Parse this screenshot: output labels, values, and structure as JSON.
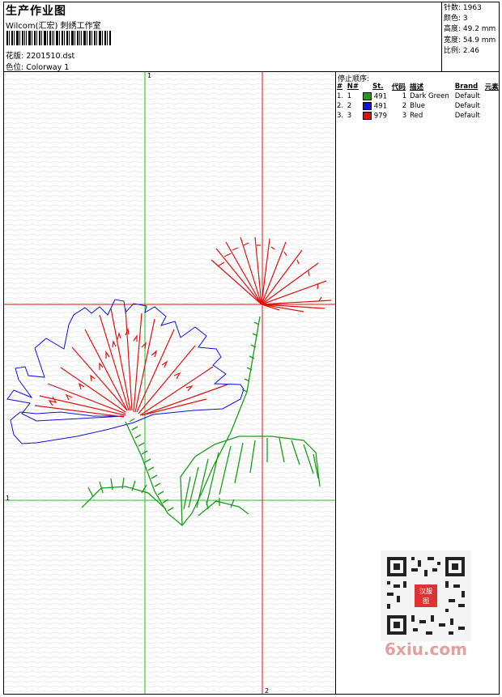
{
  "header": {
    "title": "生产作业图",
    "subtitle": "Wilcom(汇宏) 刺绣工作室",
    "design_label": "花版: 2201510.dst",
    "colorway_label": "色位: Colorway 1"
  },
  "stats": {
    "stitches": "针数: 1963",
    "colors": "颜色: 3",
    "height": "高度: 49.2 mm",
    "width": "宽度: 54.9 mm",
    "scale": "比例: 2.46"
  },
  "sequence": {
    "title": "停止顺序:",
    "headers": [
      "#",
      "N#",
      "St.",
      "代码",
      "描述",
      "Brand",
      "元素"
    ],
    "rows": [
      {
        "idx": "1.",
        "n": "1",
        "color": "#1a9c1a",
        "st": "491",
        "code": "1",
        "desc": "Dark Green",
        "brand": "Default"
      },
      {
        "idx": "2.",
        "n": "2",
        "color": "#1010e0",
        "st": "491",
        "code": "2",
        "desc": "Blue",
        "brand": "Default"
      },
      {
        "idx": "3.",
        "n": "3",
        "color": "#e01010",
        "st": "979",
        "code": "3",
        "desc": "Red",
        "brand": "Default"
      }
    ]
  },
  "grid": {
    "top_label": "1",
    "left_label": "1",
    "bottom_label": "2"
  },
  "watermark": "6xiu.com",
  "qr_badge": "汉服图"
}
